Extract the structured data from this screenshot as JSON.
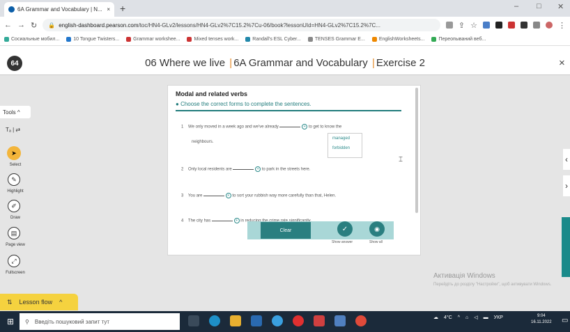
{
  "browser": {
    "tab_title": "6A Grammar and Vocabulary | N...",
    "tab_close": "×",
    "new_tab": "+",
    "url_domain": "english-dashboard.pearson.com",
    "url_path": "/toc/HN4-GLv2/lessons/HN4-GLv2%7C15.2%7Cu-06/book?lessonUId=HN4-GLv2%7C15.2%7C...",
    "bookmarks": [
      "Сосиальные мобил...",
      "10 Tongue Twisters...",
      "Grammar workshee...",
      "Mixed tenses work...",
      "Randall's ESL Cyber...",
      "TENSES Grammar E...",
      "EnglishWorksheets...",
      "Переопываний веб..."
    ]
  },
  "app": {
    "logo_text": "64",
    "title_part1": "06 Where we live",
    "title_part2": "6A Grammar and Vocabulary",
    "title_part3": "Exercise 2",
    "title_sep": "|",
    "close": "×"
  },
  "tools": {
    "toggle_label": "Tools",
    "select": "Select",
    "highlight": "Highlight",
    "draw": "Draw",
    "page_view": "Page view",
    "fullscreen": "Fullscreen",
    "lesson_flow": "Lesson flow"
  },
  "exercise": {
    "title": "Modal and related verbs",
    "instruction": "Choose the correct forms to complete the sentences.",
    "questions": [
      {
        "num": "1",
        "before": "We only moved in a week ago and we've already",
        "after": "to get to know the",
        "line2": "neighbours."
      },
      {
        "num": "2",
        "before": "Only local residents are",
        "after": "to park in the streets here."
      },
      {
        "num": "3",
        "before": "You are",
        "after": "to sort your rubbish way more carefully than that, Helen."
      },
      {
        "num": "4",
        "before": "The city has",
        "after": "in reducing the crime rate significantly."
      }
    ],
    "dropdown_options": [
      "managed",
      "forbidden"
    ],
    "clear": "Clear",
    "show_answer": "Show answer",
    "show_all": "Show all"
  },
  "windows": {
    "activate_title": "Активація Windows",
    "activate_text": "Перейдіть до розділу \"Настройки\", щоб активувати Windows.",
    "search_placeholder": "Введіть пошуковий запит тут",
    "temp": "4°C",
    "lang": "УКР",
    "time": "9:04",
    "date": "16.11.2022"
  },
  "colors": {
    "accent": "#2a7f80",
    "orange": "#e58b2a",
    "yellow": "#f5d23f"
  }
}
